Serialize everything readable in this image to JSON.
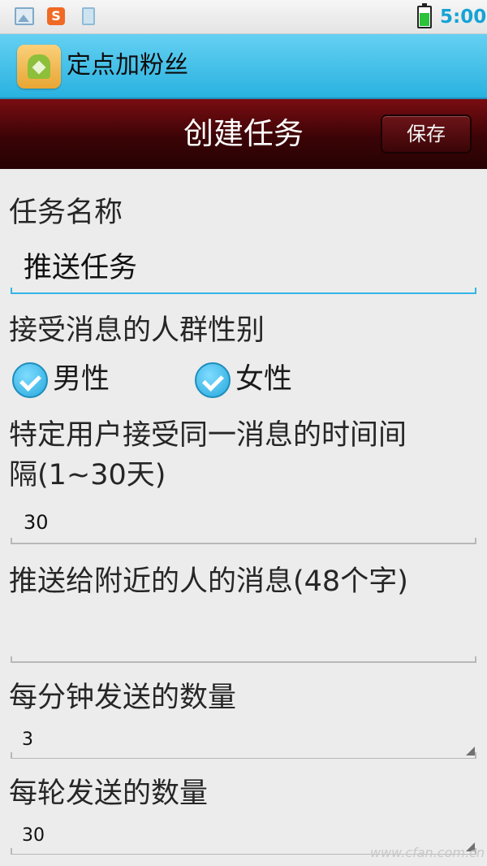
{
  "status_bar": {
    "icons": [
      "gallery-icon",
      "sogou-ime-icon",
      "clipboard-icon",
      "battery-icon"
    ],
    "time": "5:00"
  },
  "app_bar": {
    "title": "定点加粉丝",
    "icon": "android-app-icon"
  },
  "header": {
    "title": "创建任务",
    "save_label": "保存"
  },
  "form": {
    "task_name": {
      "label": "任务名称",
      "value": "推送任务"
    },
    "gender": {
      "label": "接受消息的人群性别",
      "options": [
        {
          "label": "男性",
          "checked": true
        },
        {
          "label": "女性",
          "checked": true
        }
      ]
    },
    "interval": {
      "label_line1": "特定用户接受同一消息的时间间",
      "label_line2": "隔(1~30天)",
      "value": "30"
    },
    "message": {
      "label": "推送给附近的人的消息(48个字)",
      "value": ""
    },
    "per_minute": {
      "label": "每分钟发送的数量",
      "value": "3"
    },
    "per_round": {
      "label": "每轮发送的数量",
      "value": "30"
    }
  },
  "watermark": "www.cfan.com.cn",
  "colors": {
    "accent": "#33b5e5",
    "header_dark_red": "#3b0406",
    "action_bar": "#29b2e0"
  }
}
